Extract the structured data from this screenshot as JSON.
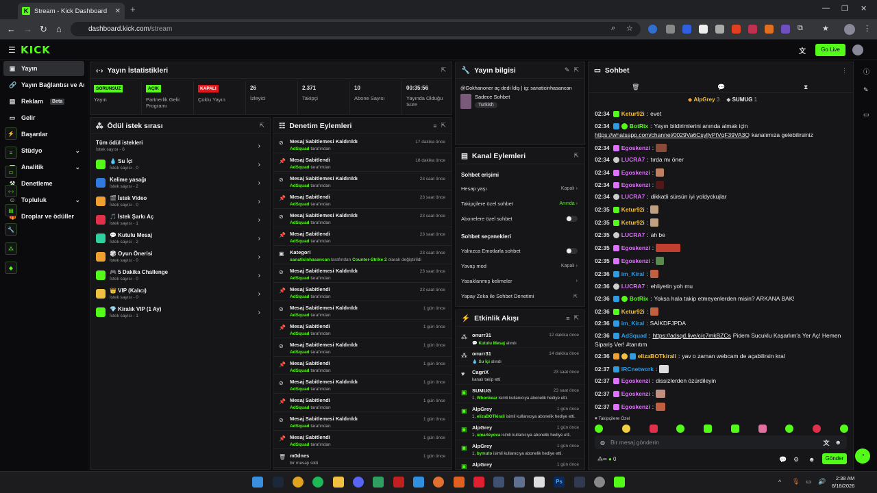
{
  "browser": {
    "tab_title": "Stream - Kick Dashboard",
    "url_host": "dashboard.kick.com",
    "url_path": "/stream"
  },
  "app": {
    "logo": "KICK",
    "go_live": "Go Live"
  },
  "sidebar": {
    "items": [
      {
        "label": "Yayın",
        "icon": "broadcast-icon"
      },
      {
        "label": "Yayın Bağlantısı ve Anahtarı",
        "icon": "link-icon"
      },
      {
        "label": "Reklam",
        "icon": "ad-icon",
        "badge": "Beta"
      },
      {
        "label": "Gelir",
        "icon": "wallet-icon"
      },
      {
        "label": "Başarılar",
        "icon": "flag-icon"
      },
      {
        "label": "Stüdyo",
        "icon": "studio-icon"
      },
      {
        "label": "Analitik",
        "icon": "chart-icon"
      },
      {
        "label": "Denetleme",
        "icon": "hammer-icon"
      },
      {
        "label": "Topluluk",
        "icon": "community-icon"
      },
      {
        "label": "Droplar ve ödüller",
        "icon": "gift-icon"
      }
    ]
  },
  "stats": {
    "title": "Yayın İstatistikleri",
    "items": [
      {
        "badge": "SORUNSUZ",
        "label": "Yayın"
      },
      {
        "badge": "AÇIK",
        "label": "Partnerlik Gelir Programı"
      },
      {
        "badge": "KAPALI",
        "label": "Çoklu Yayın"
      },
      {
        "value": "26",
        "label": "İzleyici"
      },
      {
        "value": "2.371",
        "label": "Takipçi"
      },
      {
        "value": "10",
        "label": "Abone Sayısı"
      },
      {
        "value": "00:35:56",
        "label": "Yayında Olduğu Süre"
      }
    ]
  },
  "rewards": {
    "title": "Ödül istek sırası",
    "items": [
      {
        "title": "Tüm ödül istekleri",
        "sub": "İstek sayısı - 6",
        "color": ""
      },
      {
        "title": "💧 Su İçi",
        "sub": "İstek sayısı - 0",
        "color": "#53fc18"
      },
      {
        "title": "Kelime yasağı",
        "sub": "İstek sayısı - 2",
        "color": "#2f7be0"
      },
      {
        "title": "🎬 İstek Video",
        "sub": "İstek sayısı - 0",
        "color": "#f0a030"
      },
      {
        "title": "🎵 İstek Şarkı Aç",
        "sub": "İstek sayısı - 1",
        "color": "#e0304a"
      },
      {
        "title": "💬 Kutulu Mesaj",
        "sub": "İstek sayısı - 2",
        "color": "#2fd0a0"
      },
      {
        "title": "🎲 Oyun Önerisi",
        "sub": "İstek sayısı - 0",
        "color": "#f0a030"
      },
      {
        "title": "🎮 5 Dakika Challenge",
        "sub": "İstek sayısı - 0",
        "color": "#53fc18"
      },
      {
        "title": "👑 VIP (Kalıcı)",
        "sub": "İstek sayısı - 0",
        "color": "#f0c040"
      },
      {
        "title": "💎 Kiralık VIP (1 Ay)",
        "sub": "İstek sayısı - 1",
        "color": "#53fc18"
      }
    ]
  },
  "mod_actions": {
    "title": "Denetim Eylemleri",
    "by": "tarafından",
    "items": [
      {
        "title": "Mesaj Sabitlemesi Kaldırıldı",
        "user": "AdSquad",
        "time": "17 dakika önce"
      },
      {
        "title": "Mesaj Sabitlendi",
        "user": "AdSquad",
        "time": "18 dakika önce"
      },
      {
        "title": "Mesaj Sabitlemesi Kaldırıldı",
        "user": "AdSquad",
        "time": "23 saat önce"
      },
      {
        "title": "Mesaj Sabitlendi",
        "user": "AdSquad",
        "time": "23 saat önce"
      },
      {
        "title": "Mesaj Sabitlemesi Kaldırıldı",
        "user": "AdSquad",
        "time": "23 saat önce"
      },
      {
        "title": "Mesaj Sabitlendi",
        "user": "AdSquad",
        "time": "23 saat önce"
      },
      {
        "title": "Kategori",
        "user": "sanaticinhasancan",
        "extra": "Counter-Strike 2",
        "extra_suffix": "olarak değiştirildi",
        "time": "23 saat önce"
      },
      {
        "title": "Mesaj Sabitlemesi Kaldırıldı",
        "user": "AdSquad",
        "time": "23 saat önce"
      },
      {
        "title": "Mesaj Sabitlendi",
        "user": "AdSquad",
        "time": "23 saat önce"
      },
      {
        "title": "Mesaj Sabitlemesi Kaldırıldı",
        "user": "AdSquad",
        "time": "1 gün önce"
      },
      {
        "title": "Mesaj Sabitlendi",
        "user": "AdSquad",
        "time": "1 gün önce"
      },
      {
        "title": "Mesaj Sabitlemesi Kaldırıldı",
        "user": "AdSquad",
        "time": "1 gün önce"
      },
      {
        "title": "Mesaj Sabitlendi",
        "user": "AdSquad",
        "time": "1 gün önce"
      },
      {
        "title": "Mesaj Sabitlemesi Kaldırıldı",
        "user": "AdSquad",
        "time": "1 gün önce"
      },
      {
        "title": "Mesaj Sabitlendi",
        "user": "AdSquad",
        "time": "1 gün önce"
      },
      {
        "title": "Mesaj Sabitlemesi Kaldırıldı",
        "user": "AdSquad",
        "time": "1 gün önce"
      },
      {
        "title": "Mesaj Sabitlendi",
        "user": "AdSquad",
        "time": "1 gün önce"
      },
      {
        "title": "m0dnes",
        "sub": "bir mesajı sildi",
        "time": "1 gün önce"
      }
    ]
  },
  "stream_info": {
    "title": "Yayın bilgisi",
    "stream_title": "@Gokhanoner aç dedi İdiş | ig: sanaticinhasancan",
    "category": "Sadece Sohbet",
    "tag": "Turkish"
  },
  "channel_actions": {
    "title": "Kanal Eylemleri",
    "chat_access": "Sohbet erişimi",
    "chat_options": "Sohbet seçenekleri",
    "rows": [
      {
        "label": "Hesap yaşı",
        "value": "Kapalı"
      },
      {
        "label": "Takipçilere özel sohbet",
        "value": "Anında"
      },
      {
        "label": "Abonelere özel sohbet"
      },
      {
        "label": "Yalnızca Emotlarla sohbet"
      },
      {
        "label": "Yavaş mod",
        "value": "Kapalı"
      },
      {
        "label": "Yasaklanmış kelimeler"
      },
      {
        "label": "Yapay Zeka ile Sohbet Denetimi"
      }
    ]
  },
  "activity": {
    "title": "Etkinlik Akışı",
    "items": [
      {
        "user": "onurr31",
        "reward": "Kutulu Mesaj",
        "suffix": "alındı",
        "time": "12 dakika önce"
      },
      {
        "user": "onurr31",
        "reward": "Su İçi",
        "suffix": "alındı",
        "time": "14 dakika önce"
      },
      {
        "user": "CagriX",
        "text": "kanalı takip etti",
        "time": "23 saat önce"
      },
      {
        "user": "SUMUG",
        "gift_to": "Whonkear",
        "suffix": "isimli kullanıcıya abonelik hediye etti.",
        "time": "23 saat önce"
      },
      {
        "user": "AlpGrey",
        "gift_to": "elizaBOTkirali",
        "suffix": "isimli kullanıcıya abonelik hediye etti.",
        "time": "1 gün önce"
      },
      {
        "user": "AlpGrey",
        "gift_to": "umarleyova",
        "suffix": "isimli kullanıcıya abonelik hediye etti.",
        "time": "1 gün önce"
      },
      {
        "user": "AlpGrey",
        "gift_to": "bymuto",
        "suffix": "isimli kullanıcıya abonelik hediye etti.",
        "time": "1 gün önce"
      },
      {
        "user": "AlpGrey",
        "time": "1 gün önce"
      }
    ]
  },
  "chat": {
    "title": "Sohbet",
    "gifters": [
      {
        "name": "AlpGrey",
        "count": "3"
      },
      {
        "name": "SUMUG",
        "count": "1"
      }
    ],
    "placeholder": "Bir mesaj gönderin",
    "followers_only": "Takipçilere Özel",
    "send": "Gönder",
    "points": "0",
    "messages": [
      {
        "t": "02:34",
        "u": "Ketur92i",
        "c": "#53fc18",
        "m": "evet"
      },
      {
        "t": "02:34",
        "u": "BotRix",
        "c": "#53fc18",
        "m": "Yayın bildirimlerini anında almak için",
        "m2": "https://whatsapp.com/channel/0029Va6CsyllyPtVqF39VA3Q",
        "m3": "kanalımıza gelebilirsiniz"
      },
      {
        "t": "02:34",
        "u": "Egoskenzi",
        "c": "#e070ff",
        "m": ""
      },
      {
        "t": "02:34",
        "u": "LUCRA7",
        "c": "#e070ff",
        "m": "tırda mı öner"
      },
      {
        "t": "02:34",
        "u": "Egoskenzi",
        "c": "#e070ff",
        "m": ""
      },
      {
        "t": "02:34",
        "u": "Egoskenzi",
        "c": "#e070ff",
        "m": ""
      },
      {
        "t": "02:34",
        "u": "LUCRA7",
        "c": "#e070ff",
        "m": "dikkatli sürsün iyi yoldyckujlar"
      },
      {
        "t": "02:35",
        "u": "Ketur92i",
        "c": "#53fc18",
        "m": ""
      },
      {
        "t": "02:35",
        "u": "Ketur92i",
        "c": "#53fc18",
        "m": ""
      },
      {
        "t": "02:35",
        "u": "LUCRA7",
        "c": "#e070ff",
        "m": "ah be"
      },
      {
        "t": "02:35",
        "u": "Egoskenzi",
        "c": "#e070ff",
        "m": ""
      },
      {
        "t": "02:35",
        "u": "Egoskenzi",
        "c": "#e070ff",
        "m": ""
      },
      {
        "t": "02:36",
        "u": "im_Kiral",
        "c": "#2f9be0",
        "m": ""
      },
      {
        "t": "02:36",
        "u": "LUCRA7",
        "c": "#e070ff",
        "m": "ehliyetin yoh mu"
      },
      {
        "t": "02:36",
        "u": "BotRix",
        "c": "#53fc18",
        "m": "Yoksa hala takip etmeyenlerden misin? ARKANA BAK!"
      },
      {
        "t": "02:36",
        "u": "Ketur92i",
        "c": "#53fc18",
        "m": ""
      },
      {
        "t": "02:36",
        "u": "im_Kiral",
        "c": "#2f9be0",
        "m": "SAİKDFJPDA"
      },
      {
        "t": "02:36",
        "u": "AdSquad",
        "c": "#2f9be0",
        "m": "",
        "m2": "https://adsqd.live/c/c7mkBZCs",
        "m3": "Pidem Sucuklu Kaşarlım'a Yer Aç! Hemen",
        "m4": "Sipariş Ver! #tanıtım"
      },
      {
        "t": "02:36",
        "u": "elizaBOTkirali",
        "c": "#f0c040",
        "m": "yav o zaman webcam de açabilirsin kral"
      },
      {
        "t": "02:37",
        "u": "IRCnetwork",
        "c": "#2f9be0",
        "m": ""
      },
      {
        "t": "02:37",
        "u": "Egoskenzi",
        "c": "#e070ff",
        "m": "dissizlerden özürdileyin"
      },
      {
        "t": "02:37",
        "u": "Egoskenzi",
        "c": "#e070ff",
        "m": ""
      },
      {
        "t": "02:37",
        "u": "Egoskenzi",
        "c": "#e070ff",
        "m": ""
      }
    ]
  },
  "taskbar": {
    "time": "2:38 AM",
    "date": "8/18/2026"
  }
}
